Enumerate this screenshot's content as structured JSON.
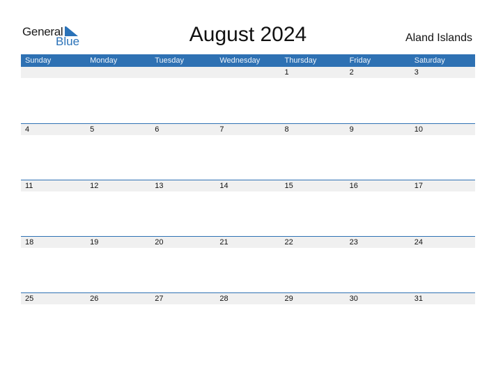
{
  "logo": {
    "line1": "General",
    "line2": "Blue"
  },
  "title": "August 2024",
  "country": "Aland Islands",
  "weekdays": [
    "Sunday",
    "Monday",
    "Tuesday",
    "Wednesday",
    "Thursday",
    "Friday",
    "Saturday"
  ],
  "weeks": [
    [
      "",
      "",
      "",
      "",
      "1",
      "2",
      "3"
    ],
    [
      "4",
      "5",
      "6",
      "7",
      "8",
      "9",
      "10"
    ],
    [
      "11",
      "12",
      "13",
      "14",
      "15",
      "16",
      "17"
    ],
    [
      "18",
      "19",
      "20",
      "21",
      "22",
      "23",
      "24"
    ],
    [
      "25",
      "26",
      "27",
      "28",
      "29",
      "30",
      "31"
    ]
  ],
  "colors": {
    "accent": "#2e71b3",
    "date_strip": "#f0f0f0"
  }
}
